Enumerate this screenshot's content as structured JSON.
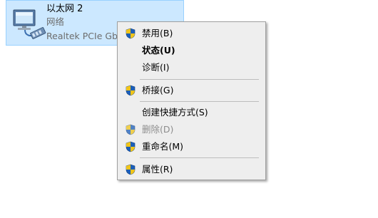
{
  "adapter": {
    "name": "以太网 2",
    "type": "网络",
    "device": "Realtek PCIe Gb",
    "icon": "network-adapter-icon",
    "selection_color": "#cce8ff"
  },
  "context_menu": {
    "items": [
      {
        "label": "禁用(B)",
        "icon": "uac-shield-icon",
        "bold": false,
        "disabled": false
      },
      {
        "label": "状态(U)",
        "icon": null,
        "bold": true,
        "disabled": false
      },
      {
        "label": "诊断(I)",
        "icon": null,
        "bold": false,
        "disabled": false
      },
      {
        "label": "桥接(G)",
        "icon": "uac-shield-icon",
        "bold": false,
        "disabled": false
      },
      {
        "label": "创建快捷方式(S)",
        "icon": null,
        "bold": false,
        "disabled": false
      },
      {
        "label": "删除(D)",
        "icon": "uac-shield-icon",
        "bold": false,
        "disabled": true
      },
      {
        "label": "重命名(M)",
        "icon": "uac-shield-icon",
        "bold": false,
        "disabled": false
      },
      {
        "label": "属性(R)",
        "icon": "uac-shield-icon",
        "bold": false,
        "disabled": false
      }
    ]
  }
}
